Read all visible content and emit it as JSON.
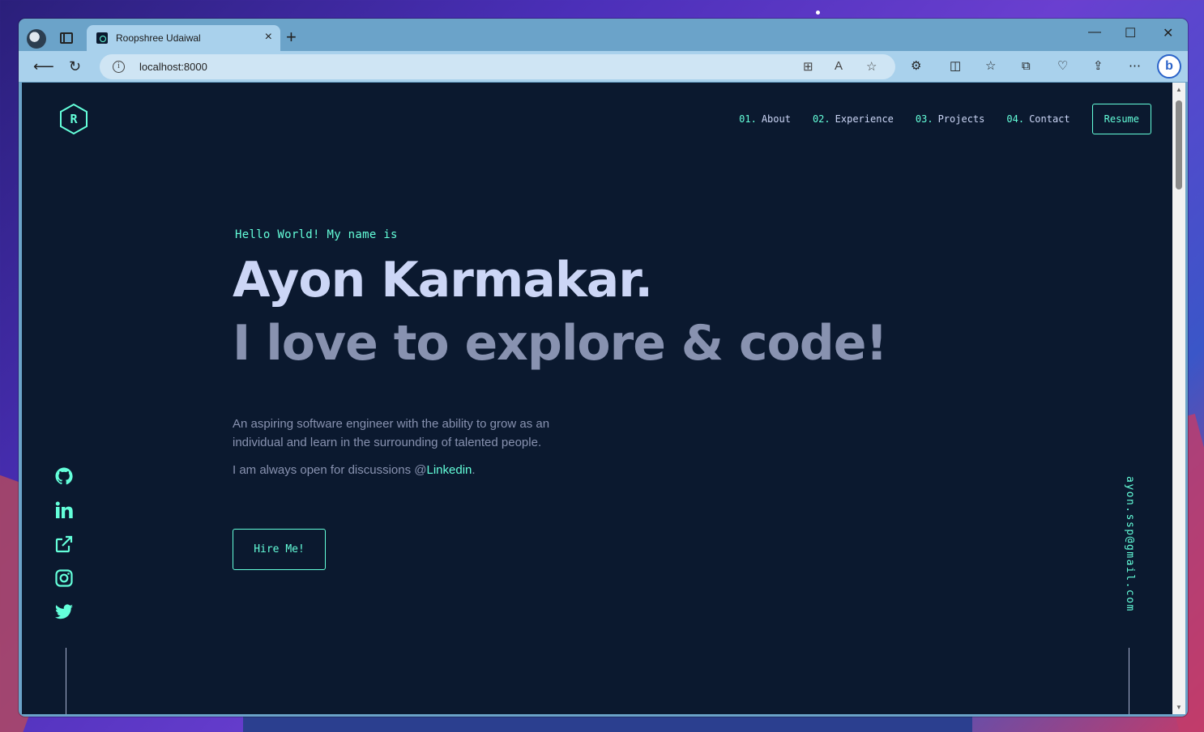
{
  "browser": {
    "tab_title": "Roopshree Udaiwal",
    "tab_close": "×",
    "new_tab": "+",
    "url": "localhost:8000",
    "minimize": "—",
    "maximize": "☐",
    "close": "✕"
  },
  "site": {
    "logo_letter": "R",
    "nav": [
      {
        "num": "01.",
        "label": "About"
      },
      {
        "num": "02.",
        "label": "Experience"
      },
      {
        "num": "03.",
        "label": "Projects"
      },
      {
        "num": "04.",
        "label": "Contact"
      }
    ],
    "resume_label": "Resume",
    "hero": {
      "greeting": "Hello World! My name is",
      "name": "Ayon Karmakar.",
      "tagline": "I love to explore & code!",
      "description": "An aspiring software engineer with the ability to grow as an individual and learn in the surrounding of talented people.",
      "open_prefix": "I am always open for discussions @",
      "open_link": "Linkedin",
      "open_suffix": ".",
      "hire_label": "Hire Me!"
    },
    "social_icons": [
      "github-icon",
      "linkedin-icon",
      "external-link-icon",
      "instagram-icon",
      "twitter-icon"
    ],
    "email": "ayon.ssp@gmail.com"
  },
  "colors": {
    "background": "#0b192f",
    "accent": "#64ffda",
    "heading": "#ccd6f6",
    "text": "#8892b0"
  }
}
